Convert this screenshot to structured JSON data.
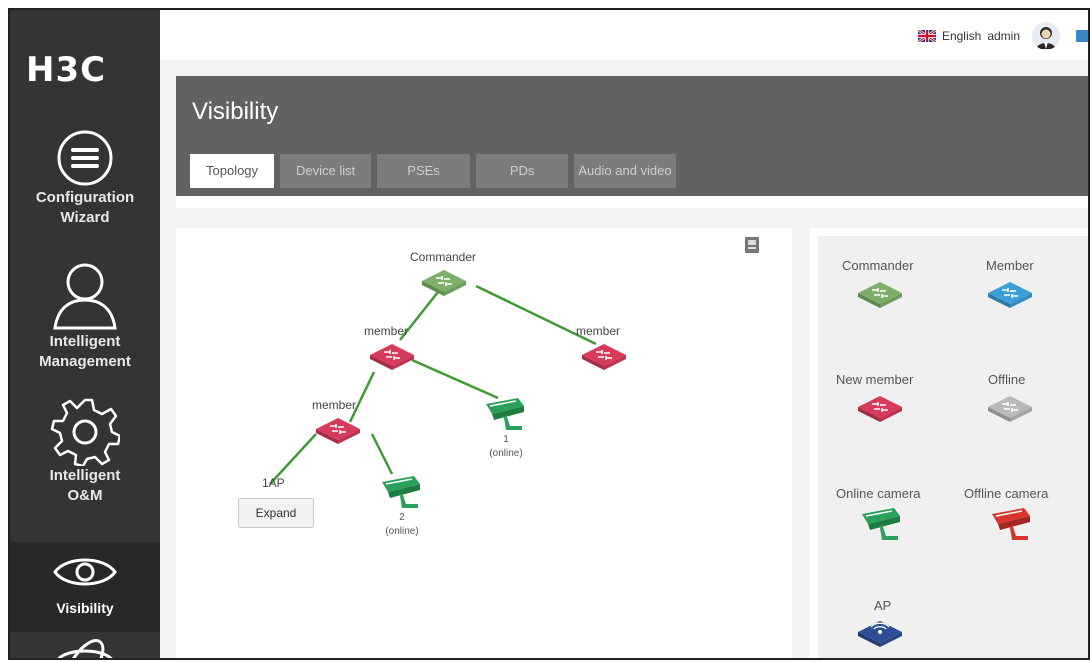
{
  "sidebar": {
    "logo": "H3C",
    "items": [
      {
        "label": "Configuration\nWizard",
        "icon": "menu-circle-icon"
      },
      {
        "label": "Intelligent\nManagement",
        "icon": "user-icon"
      },
      {
        "label": "Intelligent\nO&M",
        "icon": "gear-icon"
      },
      {
        "label": "Visibility",
        "icon": "eye-icon",
        "active": true
      },
      {
        "label": "",
        "icon": "atom-icon"
      }
    ]
  },
  "topbar": {
    "language": "English",
    "user": "admin"
  },
  "header": {
    "title": "Visibility",
    "tabs": [
      "Topology",
      "Device list",
      "PSEs",
      "PDs",
      "Audio and video"
    ],
    "active_tab": "Topology"
  },
  "topology": {
    "nodes": {
      "commander": "Commander",
      "member_left": "member",
      "member_right": "member",
      "member_lower": "member",
      "ap": "1AP",
      "camera1_id": "1",
      "camera1_status": "(online)",
      "camera2_id": "2",
      "camera2_status": "(online)"
    },
    "expand_label": "Expand"
  },
  "legend": {
    "commander": "Commander",
    "member": "Member",
    "new_member": "New member",
    "offline": "Offline",
    "online_camera": "Online camera",
    "offline_camera": "Offline camera",
    "ap": "AP"
  },
  "colors": {
    "commander": "#7fae6a",
    "member": "#3e9fd6",
    "new_member": "#d83a5a",
    "offline": "#b9b9b9",
    "online_camera": "#2aa15a",
    "offline_camera": "#d8352c",
    "ap": "#2d4f96",
    "link": "#3f9a34"
  }
}
